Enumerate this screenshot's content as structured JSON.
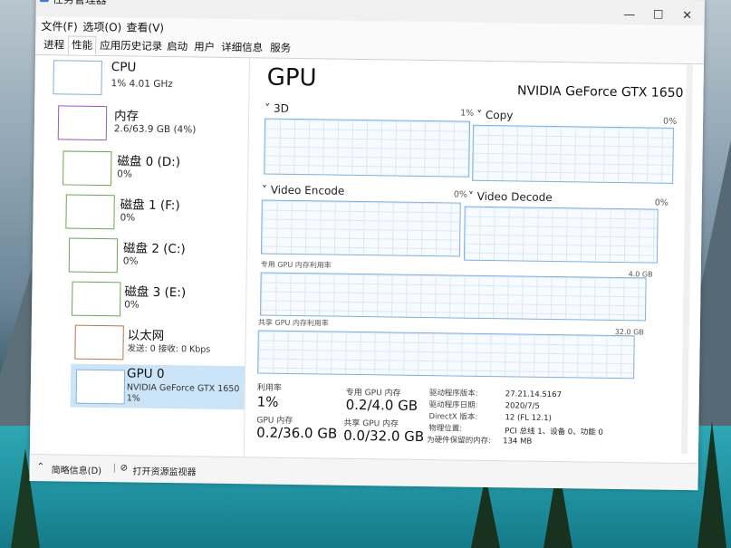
{
  "window": {
    "title": "任务管理器"
  },
  "menu": [
    "文件(F)",
    "选项(O)",
    "查看(V)"
  ],
  "tabs": [
    "进程",
    "性能",
    "应用历史记录",
    "启动",
    "用户",
    "详细信息",
    "服务"
  ],
  "active_tab": 1,
  "sidebar": [
    {
      "name": "CPU",
      "sub": "1% 4.01 GHz"
    },
    {
      "name": "内存",
      "sub": "2.6/63.9 GB (4%)"
    },
    {
      "name": "磁盘 0 (D:)",
      "sub": "0%"
    },
    {
      "name": "磁盘 1 (F:)",
      "sub": "0%"
    },
    {
      "name": "磁盘 2 (C:)",
      "sub": "0%"
    },
    {
      "name": "磁盘 3 (E:)",
      "sub": "0%"
    },
    {
      "name": "以太网",
      "sub": "发送: 0 接收: 0 Kbps"
    },
    {
      "name": "GPU 0",
      "sub": "NVIDIA GeForce GTX 1650",
      "sub2": "1%"
    }
  ],
  "gpu": {
    "heading": "GPU",
    "model": "NVIDIA GeForce GTX 1650",
    "engines": [
      {
        "name": "3D",
        "pct": "1%"
      },
      {
        "name": "Copy",
        "pct": "0%"
      },
      {
        "name": "Video Encode",
        "pct": "0%"
      },
      {
        "name": "Video Decode",
        "pct": "0%"
      }
    ],
    "dedicated_label": "专用 GPU 内存利用率",
    "dedicated_max": "4.0 GB",
    "shared_label": "共享 GPU 内存利用率",
    "shared_max": "32.0 GB",
    "stats": {
      "util_label": "利用率",
      "util_value": "1%",
      "ded_label": "专用 GPU 内存",
      "ded_value": "0.2/4.0 GB",
      "gpu_mem_label": "GPU 内存",
      "gpu_mem_value": "0.2/36.0 GB",
      "shared_label": "共享 GPU 内存",
      "shared_value": "0.0/32.0 GB"
    },
    "details": [
      {
        "k": "驱动程序版本:",
        "v": "27.21.14.5167"
      },
      {
        "k": "驱动程序日期:",
        "v": "2020/7/5"
      },
      {
        "k": "DirectX 版本:",
        "v": "12 (FL 12.1)"
      },
      {
        "k": "物理位置:",
        "v": "PCI 总线 1、设备 0、功能 0"
      },
      {
        "k": "为硬件保留的内存:",
        "v": "134 MB"
      }
    ]
  },
  "footer": {
    "less": "简略信息(D)",
    "monitor": "打开资源监视器"
  },
  "colors": {
    "accent": "#7fb0e0",
    "selected": "#cce4f7",
    "memory": "#9b59b6",
    "disk": "#6aa84f",
    "ethernet": "#b7784b"
  }
}
